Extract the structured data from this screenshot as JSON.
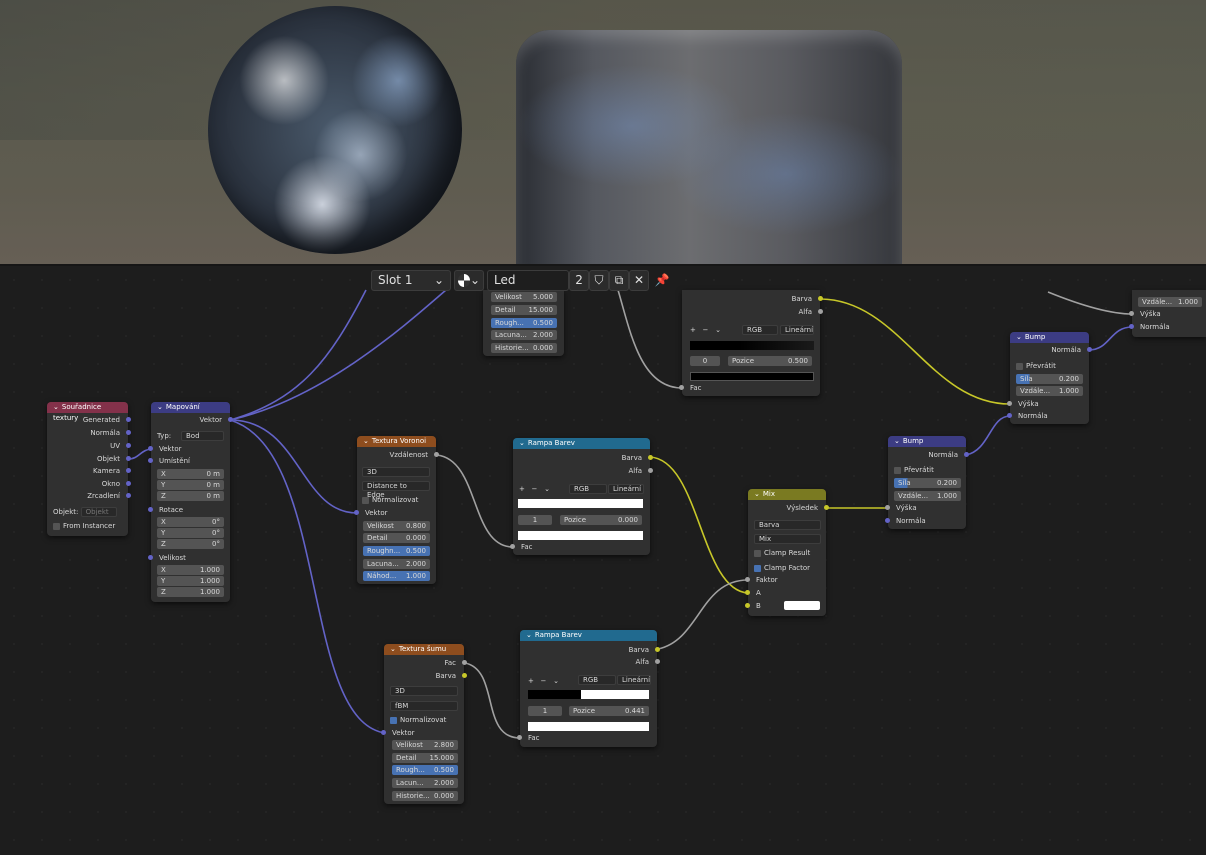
{
  "header": {
    "slot": "Slot 1",
    "material_name": "Led",
    "users": "2"
  },
  "nodes": {
    "texcoord": {
      "title": "Souřadnice textury",
      "outputs": [
        "Generated",
        "Normála",
        "UV",
        "Objekt",
        "Kamera",
        "Okno",
        "Zrcadlení"
      ],
      "object_label": "Objekt:",
      "object_placeholder": "Objekt",
      "from_instancer": "From Instancer"
    },
    "mapping": {
      "title": "Mapování",
      "output": "Vektor",
      "type_label": "Typ:",
      "type_value": "Bod",
      "vector": "Vektor",
      "location": "Umístění",
      "loc": [
        [
          "X",
          "0 m"
        ],
        [
          "Y",
          "0 m"
        ],
        [
          "Z",
          "0 m"
        ]
      ],
      "rotation": "Rotace",
      "rot": [
        [
          "X",
          "0°"
        ],
        [
          "Y",
          "0°"
        ],
        [
          "Z",
          "0°"
        ]
      ],
      "scale": "Velikost",
      "scl": [
        [
          "X",
          "1.000"
        ],
        [
          "Y",
          "1.000"
        ],
        [
          "Z",
          "1.000"
        ]
      ]
    },
    "noise_top": {
      "fields": [
        [
          "Velikost",
          "5.000"
        ],
        [
          "Detail",
          "15.000"
        ],
        [
          "Rough...",
          "0.500"
        ],
        [
          "Lacuna...",
          "2.000"
        ],
        [
          "Historie...",
          "0.000"
        ]
      ]
    },
    "ramp_top": {
      "out1": "Barva",
      "out2": "Alfa",
      "mode": "RGB",
      "interp": "Lineární",
      "index": "0",
      "pos_label": "Pozice",
      "pos_value": "0.500",
      "fac": "Fac"
    },
    "voronoi": {
      "title": "Textura Voronoi",
      "output": "Vzdálenost",
      "dim": "3D",
      "feature": "Distance to Edge",
      "normalize": "Normalizovat",
      "vector": "Vektor",
      "fields": [
        [
          "Velikost",
          "0.800"
        ],
        [
          "Detail",
          "0.000"
        ],
        [
          "Roughn...",
          "0.500"
        ],
        [
          "Lacuna...",
          "2.000"
        ],
        [
          "Náhod...",
          "1.000"
        ]
      ]
    },
    "ramp_mid": {
      "title": "Rampa Barev",
      "out1": "Barva",
      "out2": "Alfa",
      "mode": "RGB",
      "interp": "Lineární",
      "index": "1",
      "pos_label": "Pozice",
      "pos_value": "0.000",
      "fac": "Fac"
    },
    "noise": {
      "title": "Textura šumu",
      "out1": "Fac",
      "out2": "Barva",
      "dim": "3D",
      "type": "fBM",
      "normalize": "Normalizovat",
      "vector": "Vektor",
      "fields": [
        [
          "Velikost",
          "2.800"
        ],
        [
          "Detail",
          "15.000"
        ],
        [
          "Rough...",
          "0.500"
        ],
        [
          "Lacun...",
          "2.000"
        ],
        [
          "Historie...",
          "0.000"
        ]
      ]
    },
    "ramp_bot": {
      "title": "Rampa Barev",
      "out1": "Barva",
      "out2": "Alfa",
      "mode": "RGB",
      "interp": "Lineární",
      "index": "1",
      "pos_label": "Pozice",
      "pos_value": "0.441",
      "fac": "Fac"
    },
    "mix": {
      "title": "Mix",
      "output": "Výsledek",
      "data_type": "Barva",
      "blend": "Mix",
      "clamp_result": "Clamp Result",
      "clamp_factor": "Clamp Factor",
      "factor": "Faktor",
      "a": "A",
      "b": "B"
    },
    "bump_mid": {
      "title": "Bump",
      "output": "Normála",
      "invert": "Převrátit",
      "strength_label": "Síla",
      "strength": "0.200",
      "dist_label": "Vzdále...",
      "dist": "1.000",
      "height": "Výška",
      "normal": "Normála"
    },
    "bump_top": {
      "title": "Bump",
      "output": "Normála",
      "invert": "Převrátit",
      "strength_label": "Síla",
      "strength": "0.200",
      "dist_label": "Vzdále...",
      "dist": "1.000",
      "height": "Výška",
      "normal": "Normála"
    },
    "bump_edge": {
      "dist_label": "Vzdále...",
      "dist": "1.000",
      "height": "Výška",
      "normal": "Normála"
    }
  }
}
